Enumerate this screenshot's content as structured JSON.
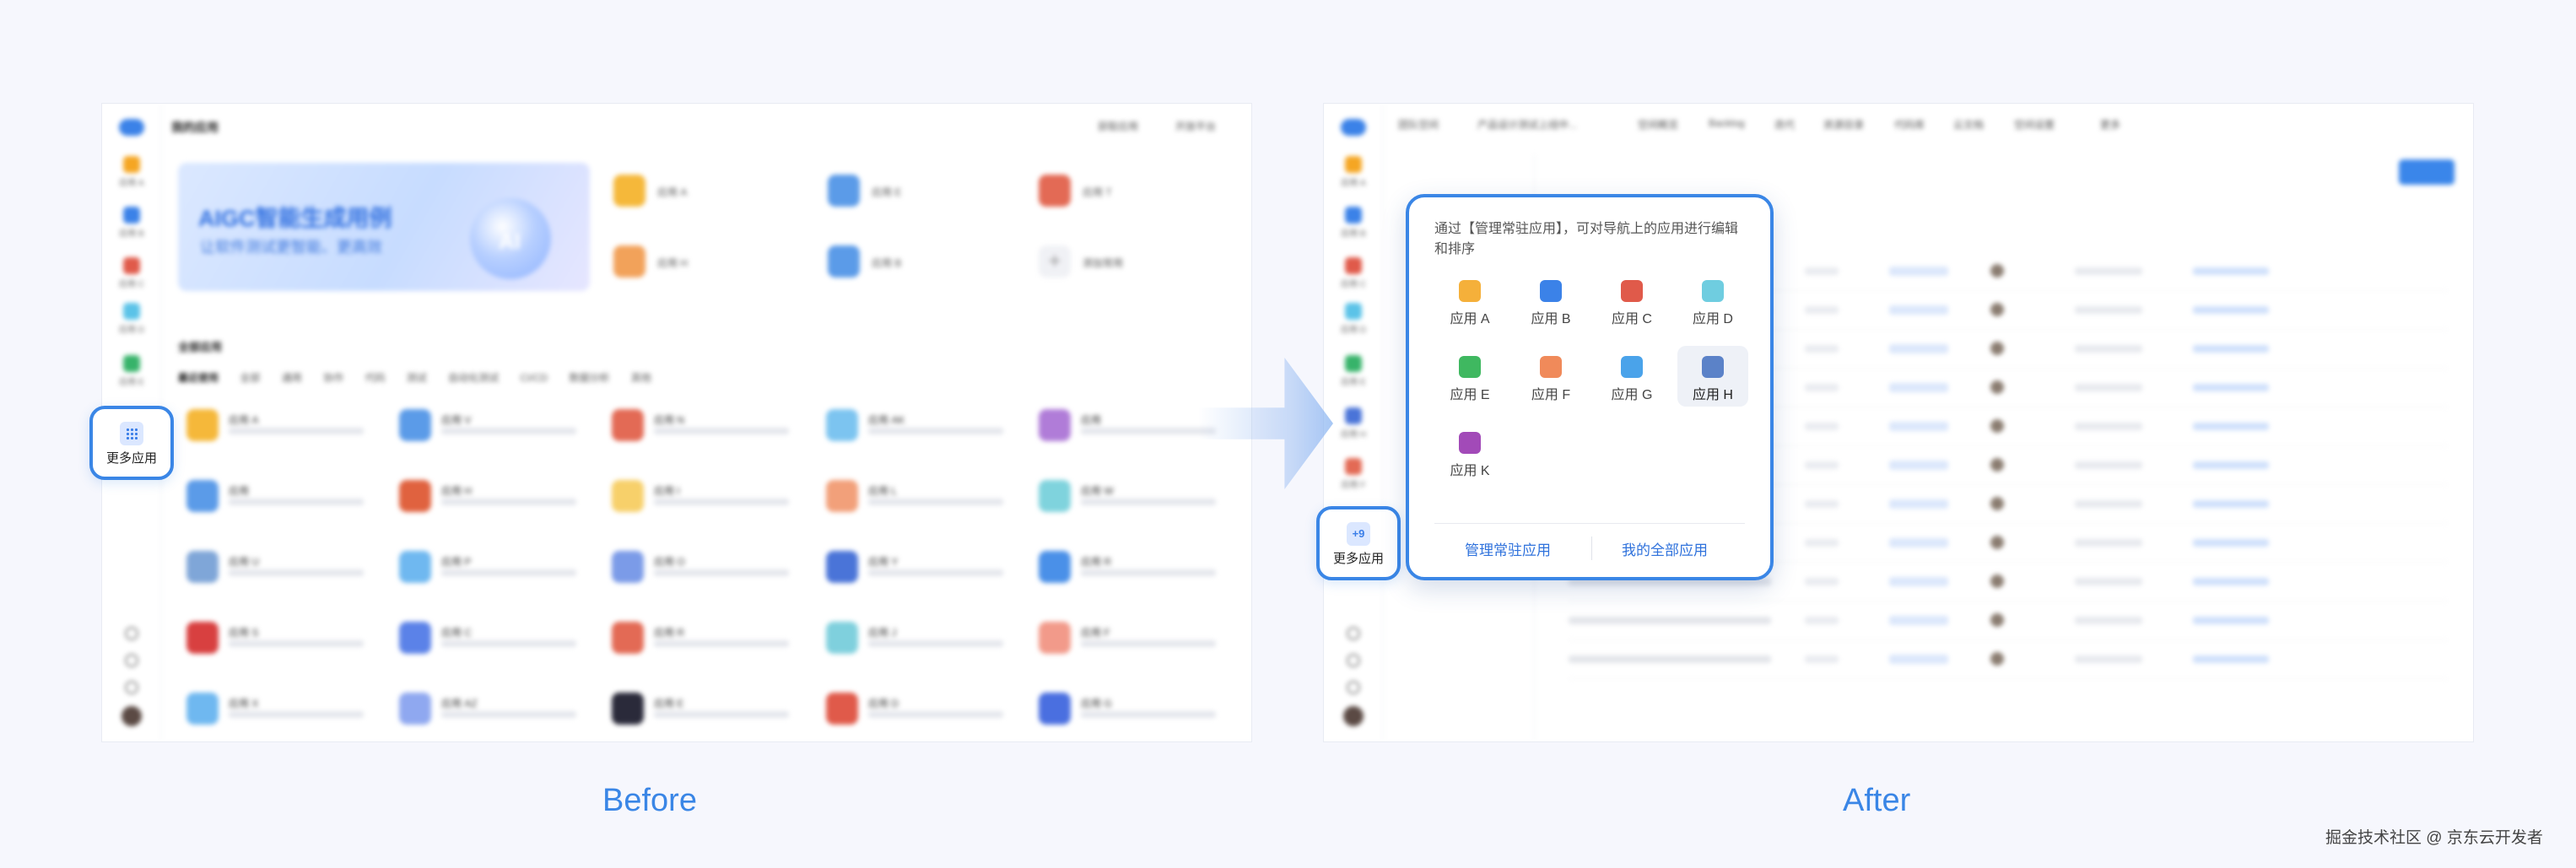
{
  "before": {
    "title": "我的应用",
    "topright": [
      "获取应用",
      "开放平台"
    ],
    "sidebar_apps": [
      {
        "label": "应用 A",
        "color": "#f5a623"
      },
      {
        "label": "应用 B",
        "color": "#3b82e8"
      },
      {
        "label": "应用 C",
        "color": "#e05a4a"
      },
      {
        "label": "应用 D",
        "color": "#5bc3e8"
      },
      {
        "label": "应用 E",
        "color": "#37b36a"
      }
    ],
    "more_button": {
      "label": "更多应用"
    },
    "banner": {
      "title": "AIGC智能生成用例",
      "subtitle": "让软件测试更智能、更高效",
      "badge": "AI"
    },
    "quick_apps": [
      {
        "label": "应用 A",
        "color": "#f5b83a"
      },
      {
        "label": "应用 E",
        "color": "#5b9be8"
      },
      {
        "label": "应用 T",
        "color": "#e36a55"
      },
      {
        "label": "应用 H",
        "color": "#f2a25a"
      },
      {
        "label": "应用 B",
        "color": "#5b9be8"
      }
    ],
    "add_label": "添加常用",
    "section_title": "全部应用",
    "filters": [
      "最近使用",
      "全部",
      "通用",
      "协作",
      "代码",
      "测试",
      "自动化测试",
      "CI/CD",
      "数据分析",
      "其他"
    ],
    "grid_apps": [
      [
        {
          "name": "应用 A",
          "color": "#f5b83a"
        },
        {
          "name": "应用 V",
          "color": "#5b9be8"
        },
        {
          "name": "应用 N",
          "color": "#e36a55"
        },
        {
          "name": "应用 AK",
          "color": "#7cc4f0"
        },
        {
          "name": "应用",
          "color": "#b07cd8"
        }
      ],
      [
        {
          "name": "应用",
          "color": "#5b9be8"
        },
        {
          "name": "应用 H",
          "color": "#e0623f"
        },
        {
          "name": "应用 I",
          "color": "#f7d06a"
        },
        {
          "name": "应用 L",
          "color": "#f2a07a"
        },
        {
          "name": "应用 W",
          "color": "#7fd3dd"
        }
      ],
      [
        {
          "name": "应用 U",
          "color": "#7fa6d8"
        },
        {
          "name": "应用 P",
          "color": "#6fb8f0"
        },
        {
          "name": "应用 O",
          "color": "#7b9be8"
        },
        {
          "name": "应用 Y",
          "color": "#4a74d8"
        },
        {
          "name": "应用 R",
          "color": "#4a90e8"
        }
      ],
      [
        {
          "name": "应用 S",
          "color": "#d84040"
        },
        {
          "name": "应用 C",
          "color": "#5b82e8"
        },
        {
          "name": "应用 R",
          "color": "#e36a55"
        },
        {
          "name": "应用 J",
          "color": "#7fd0dd"
        },
        {
          "name": "应用 F",
          "color": "#f29a8a"
        }
      ],
      [
        {
          "name": "应用 X",
          "color": "#6fb8f0"
        },
        {
          "name": "应用 AZ",
          "color": "#8fa8f0"
        },
        {
          "name": "应用 E",
          "color": "#2a2a3a"
        },
        {
          "name": "应用 D",
          "color": "#e05a4a"
        },
        {
          "name": "应用 G",
          "color": "#4a6fe0"
        }
      ]
    ]
  },
  "after": {
    "top_tabs": [
      "团队空间",
      "产品设计测试上线中...",
      "空间概览",
      "Backlog",
      "迭代",
      "资源目录",
      "代码库",
      "云文档",
      "空间设置",
      "更多"
    ],
    "sidebar_apps": [
      {
        "label": "应用 A",
        "color": "#f5a623"
      },
      {
        "label": "应用 B",
        "color": "#3b82e8"
      },
      {
        "label": "应用 C",
        "color": "#e05a4a"
      },
      {
        "label": "应用 D",
        "color": "#5bc3e8"
      },
      {
        "label": "应用 E",
        "color": "#37b36a"
      },
      {
        "label": "应用 H",
        "color": "#4a74d8"
      },
      {
        "label": "应用 F",
        "color": "#e36a55"
      }
    ],
    "more_button": {
      "badge": "+9",
      "label": "更多应用"
    },
    "popup": {
      "hint": "通过【管理常驻应用】，可对导航上的应用进行编辑和排序",
      "apps": [
        {
          "label": "应用 A",
          "color": "#f5b03a"
        },
        {
          "label": "应用 B",
          "color": "#3b82e8"
        },
        {
          "label": "应用 C",
          "color": "#e05a4a"
        },
        {
          "label": "应用 D",
          "color": "#6fcde0"
        },
        {
          "label": "应用 E",
          "color": "#3fb860"
        },
        {
          "label": "应用 F",
          "color": "#f08a5a"
        },
        {
          "label": "应用 G",
          "color": "#4aa3ea"
        },
        {
          "label": "应用 H",
          "color": "#5b82c8",
          "selected": true
        },
        {
          "label": "应用 K",
          "color": "#a24ab8"
        }
      ],
      "manage_link": "管理常驻应用",
      "all_link": "我的全部应用"
    }
  },
  "captions": {
    "before": "Before",
    "after": "After"
  },
  "watermark": "掘金技术社区 @ 京东云开发者",
  "colors": {
    "accent": "#3a86e6",
    "background": "#f6f7fd"
  }
}
